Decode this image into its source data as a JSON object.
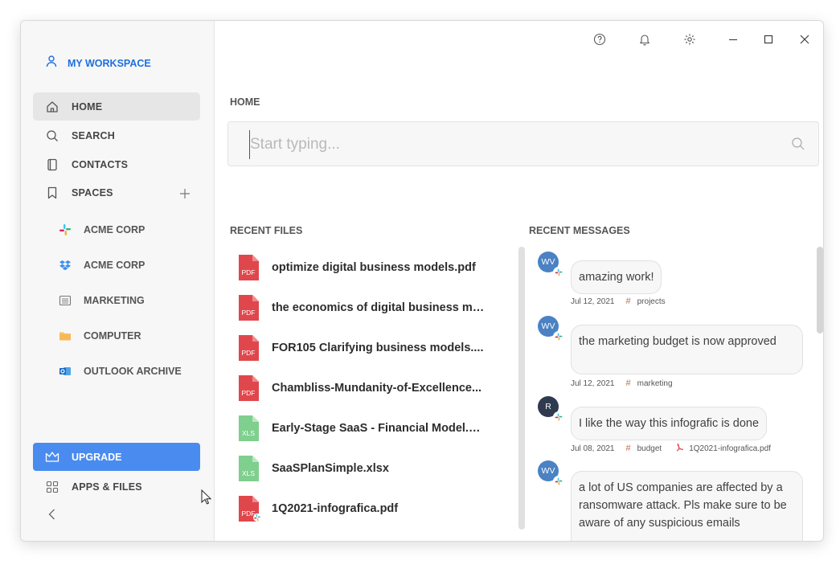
{
  "sidebar": {
    "workspace_label": "MY WORKSPACE",
    "nav": [
      {
        "label": "HOME",
        "icon": "home-icon"
      },
      {
        "label": "SEARCH",
        "icon": "search-icon"
      },
      {
        "label": "CONTACTS",
        "icon": "contacts-icon"
      },
      {
        "label": "SPACES",
        "icon": "bookmark-icon"
      }
    ],
    "spaces": [
      {
        "label": "ACME CORP",
        "icon": "slack-icon"
      },
      {
        "label": "ACME CORP",
        "icon": "dropbox-icon"
      },
      {
        "label": "MARKETING",
        "icon": "list-icon"
      },
      {
        "label": "COMPUTER",
        "icon": "folder-icon"
      },
      {
        "label": "OUTLOOK ARCHIVE",
        "icon": "outlook-icon"
      }
    ],
    "upgrade_label": "UPGRADE",
    "apps_label": "APPS & FILES"
  },
  "main": {
    "breadcrumb": "HOME",
    "search_placeholder": "Start typing...",
    "recent_files_title": "RECENT FILES",
    "recent_messages_title": "RECENT MESSAGES"
  },
  "files": [
    {
      "name": "optimize digital business models.pdf",
      "type": "PDF"
    },
    {
      "name": "the economics of digital business mo...",
      "type": "PDF"
    },
    {
      "name": "FOR105 Clarifying business models....",
      "type": "PDF"
    },
    {
      "name": "Chambliss-Mundanity-of-Excellence...",
      "type": "PDF"
    },
    {
      "name": "Early-Stage SaaS - Financial Model.x...",
      "type": "XLS"
    },
    {
      "name": "SaaSPlanSimple.xlsx",
      "type": "XLS"
    },
    {
      "name": "1Q2021-infografica.pdf",
      "type": "PDF"
    }
  ],
  "messages": [
    {
      "initials": "WV",
      "text": "amazing work!",
      "date": "Jul 12, 2021",
      "channel": "projects"
    },
    {
      "initials": "WV",
      "text": "the marketing budget is now approved",
      "date": "Jul 12, 2021",
      "channel": "marketing"
    },
    {
      "initials": "R",
      "text": "I like the way this infografic is done",
      "date": "Jul 08, 2021",
      "channel": "budget",
      "attachment": "1Q2021-infografica.pdf"
    },
    {
      "initials": "WV",
      "text": "a lot of US companies are affected by a ransomware attack. Pls make sure to be aware of any suspicious emails"
    }
  ],
  "colors": {
    "accent": "#1e6fe0",
    "upgrade_bg": "#4a8bf0",
    "pdf_red": "#e0474c",
    "xls_green": "#7fcf8e",
    "avatar_blue": "#4a82c3",
    "avatar_dark": "#2f3a4f"
  }
}
